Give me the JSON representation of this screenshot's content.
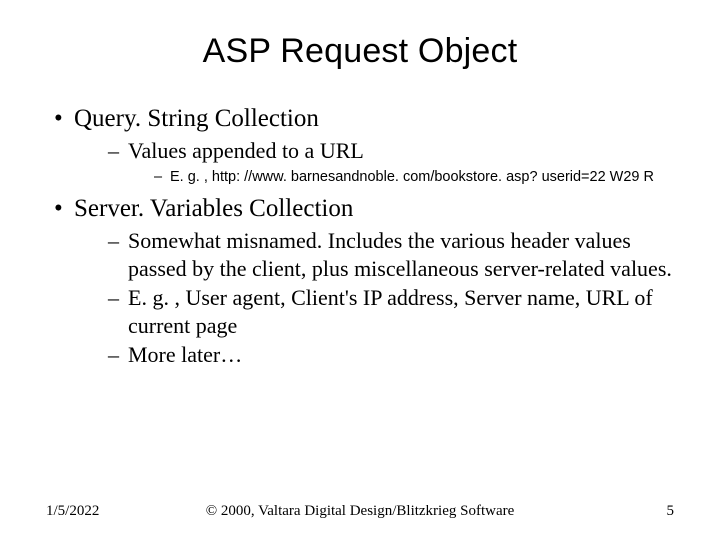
{
  "title": "ASP Request Object",
  "bullets": [
    {
      "text": "Query. String Collection",
      "sub": [
        {
          "text": "Values appended to a URL",
          "sub": [
            {
              "text": "E. g. , http: //www. barnesandnoble. com/bookstore. asp? userid=22 W29 R"
            }
          ]
        }
      ]
    },
    {
      "text": "Server. Variables Collection",
      "sub": [
        {
          "text": "Somewhat misnamed. Includes the various header values passed by the client, plus miscellaneous server-related values."
        },
        {
          "text": "E. g. , User agent, Client's IP address, Server name, URL of current page"
        },
        {
          "text": "More later…"
        }
      ]
    }
  ],
  "footer": {
    "date": "1/5/2022",
    "copyright": "© 2000, Valtara Digital Design/Blitzkrieg Software",
    "page": "5"
  }
}
